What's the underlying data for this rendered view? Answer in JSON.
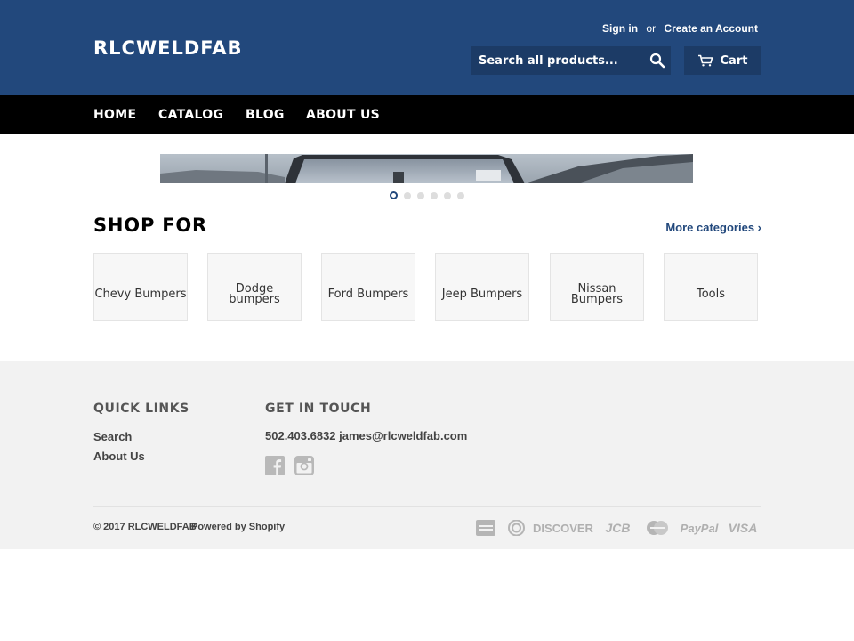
{
  "header": {
    "logo": "RLCWELDFAB",
    "account": {
      "sign_in": "Sign in",
      "or": "or",
      "create_account": "Create an Account"
    },
    "search": {
      "placeholder": "Search all products..."
    },
    "cart_label": "Cart"
  },
  "nav": {
    "items": [
      {
        "label": "HOME"
      },
      {
        "label": "CATALOG"
      },
      {
        "label": "BLOG"
      },
      {
        "label": "ABOUT US"
      }
    ]
  },
  "slider": {
    "slide_count": 6,
    "active_index": 0
  },
  "shop": {
    "title": "SHOP FOR",
    "more_label": "More categories ›",
    "categories": [
      {
        "label": "Chevy Bumpers"
      },
      {
        "label": "Dodge bumpers"
      },
      {
        "label": "Ford Bumpers"
      },
      {
        "label": "Jeep Bumpers"
      },
      {
        "label": "Nissan Bumpers"
      },
      {
        "label": "Tools"
      }
    ]
  },
  "footer": {
    "quick_links": {
      "heading": "QUICK LINKS",
      "links": [
        {
          "label": "Search"
        },
        {
          "label": "About Us"
        }
      ]
    },
    "get_in_touch": {
      "heading": "GET IN TOUCH",
      "contact": "502.403.6832 james@rlcweldfab.com"
    },
    "copyright": "© 2017 RLCWELDFAB",
    "powered_by": "Powered by Shopify",
    "payment_methods": [
      {
        "name": "american-express-icon",
        "text": ""
      },
      {
        "name": "diners-club-icon",
        "text": ""
      },
      {
        "name": "discover-icon",
        "text": "DISCOVER"
      },
      {
        "name": "jcb-icon",
        "text": "JCB"
      },
      {
        "name": "mastercard-icon",
        "text": ""
      },
      {
        "name": "paypal-icon",
        "text": "PayPal"
      },
      {
        "name": "visa-icon",
        "text": "VISA"
      }
    ]
  },
  "colors": {
    "brand": "#22487c",
    "nav": "#000000",
    "footer": "#f2f2f2"
  }
}
